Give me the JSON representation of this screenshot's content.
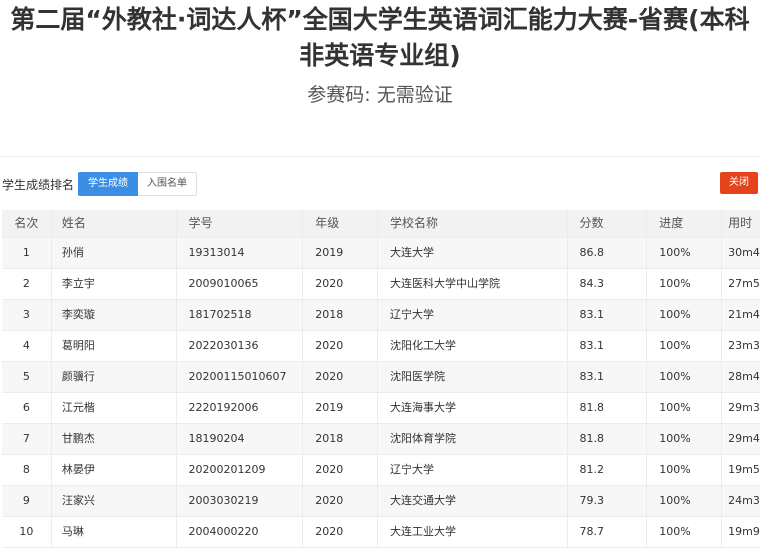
{
  "header": {
    "title": "第二届“外教社·词达人杯”全国大学生英语词汇能力大赛-省赛(本科非英语专业组)",
    "code_label": "参赛码:",
    "code_value": "无需验证"
  },
  "toolbar": {
    "rank_label": "学生成绩排名",
    "tabs": [
      {
        "label": "学生成绩",
        "active": true
      },
      {
        "label": "入围名单",
        "active": false
      }
    ],
    "close_label": "关闭"
  },
  "table": {
    "columns": [
      "名次",
      "姓名",
      "学号",
      "年级",
      "学校名称",
      "分数",
      "进度",
      "用时"
    ],
    "rows": [
      [
        "1",
        "孙俏",
        "19313014",
        "2019",
        "大连大学",
        "86.8",
        "100%",
        "30m4"
      ],
      [
        "2",
        "李立宇",
        "2009010065",
        "2020",
        "大连医科大学中山学院",
        "84.3",
        "100%",
        "27m5"
      ],
      [
        "3",
        "李奕璇",
        "181702518",
        "2018",
        "辽宁大学",
        "83.1",
        "100%",
        "21m4"
      ],
      [
        "4",
        "葛明阳",
        "2022030136",
        "2020",
        "沈阳化工大学",
        "83.1",
        "100%",
        "23m3"
      ],
      [
        "5",
        "颜骥行",
        "20200115010607",
        "2020",
        "沈阳医学院",
        "83.1",
        "100%",
        "28m4"
      ],
      [
        "6",
        "江元楷",
        "2220192006",
        "2019",
        "大连海事大学",
        "81.8",
        "100%",
        "29m3"
      ],
      [
        "7",
        "甘鹏杰",
        "18190204",
        "2018",
        "沈阳体育学院",
        "81.8",
        "100%",
        "29m4"
      ],
      [
        "8",
        "林晏伊",
        "20200201209",
        "2020",
        "辽宁大学",
        "81.2",
        "100%",
        "19m5"
      ],
      [
        "9",
        "汪家兴",
        "2003030219",
        "2020",
        "大连交通大学",
        "79.3",
        "100%",
        "24m3"
      ],
      [
        "10",
        "马琳",
        "2004000220",
        "2020",
        "大连工业大学",
        "78.7",
        "100%",
        "19m9"
      ]
    ]
  },
  "colors": {
    "accent_blue": "#3a8ee6",
    "close_red": "#e4431c"
  }
}
